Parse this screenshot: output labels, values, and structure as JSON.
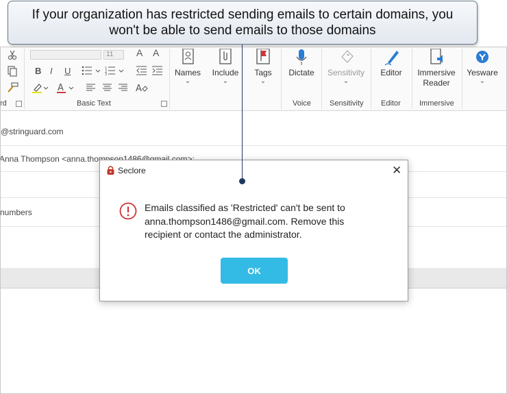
{
  "callout": {
    "line1": "If your organization has restricted sending emails to certain domains, you",
    "line2": "won't be able to send emails to those domains"
  },
  "ribbon": {
    "font_size_value": "11",
    "groups": {
      "clipboard_fragment": "rd",
      "basic_text": "Basic Text",
      "voice": "Voice",
      "sensitivity": "Sensitivity",
      "editor": "Editor",
      "immersive": "Immersive"
    },
    "buttons": {
      "names": "Names",
      "include": "Include",
      "tags": "Tags",
      "dictate": "Dictate",
      "sensitivity": "Sensitivity",
      "editor": "Editor",
      "immersive_reader_1": "Immersive",
      "immersive_reader_2": "Reader",
      "yesware": "Yesware"
    },
    "format_glyphs": {
      "bold": "B",
      "italic": "I",
      "underline": "U"
    }
  },
  "compose": {
    "from": "@stringuard.com",
    "to": "Anna Thompson <anna.thompson1486@gmail.com>;",
    "subject_fragment": "numbers"
  },
  "dialog": {
    "title": "Seclore",
    "message_line1": "Emails classified as 'Restricted' can't be sent to",
    "message_line2": "anna.thompson1486@gmail.com. Remove this",
    "message_line3": "recipient or contact the administrator.",
    "ok_label": "OK"
  },
  "colors": {
    "ok_button": "#33bbe6",
    "warning_red": "#d13438",
    "callout_border": "#6b7b8c",
    "pointer": "#1f3a5f"
  }
}
